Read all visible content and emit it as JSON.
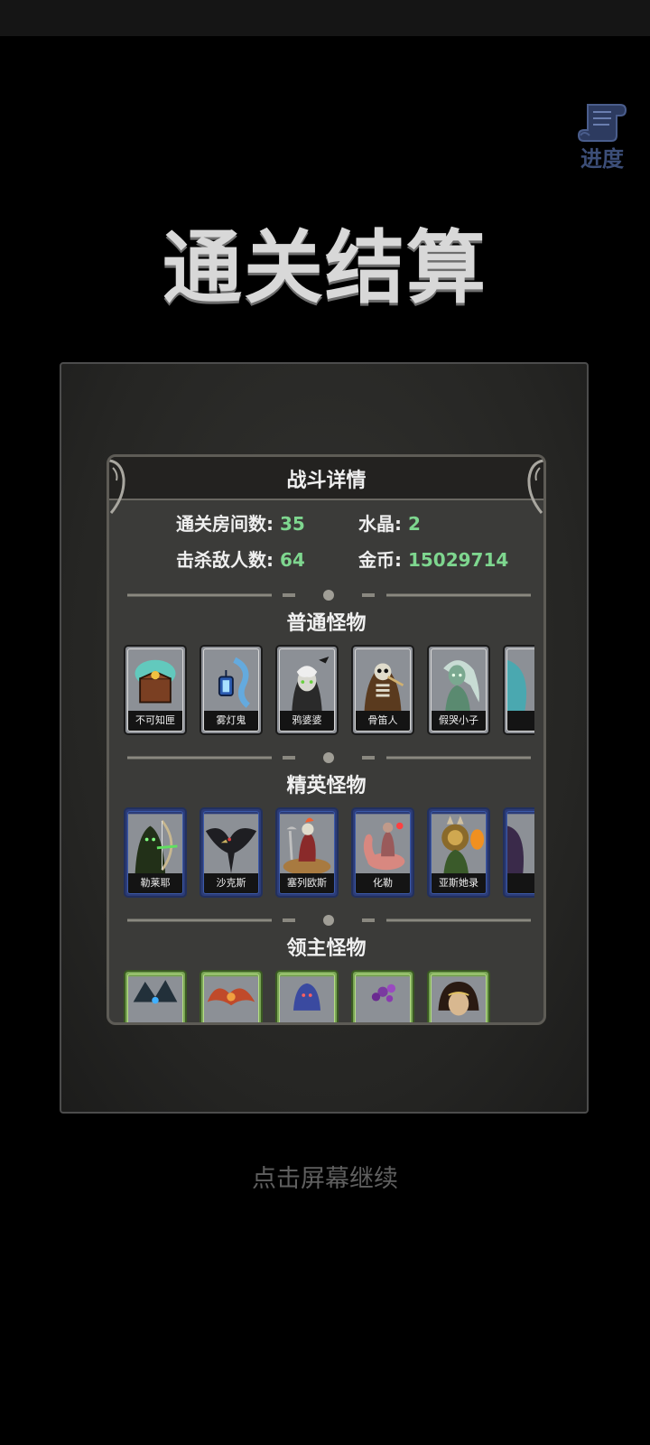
{
  "title": "通关结算",
  "progress_button": {
    "label": "进度",
    "icon": "scroll-icon"
  },
  "battle_details": {
    "header": "战斗详情",
    "stats": [
      {
        "label": "通关房间数:",
        "value": "35"
      },
      {
        "label": "水晶:",
        "value": "2"
      },
      {
        "label": "击杀敌人数:",
        "value": "64"
      },
      {
        "label": "金币:",
        "value": "15029714"
      }
    ]
  },
  "sections": {
    "normal": {
      "title": "普通怪物",
      "monsters": [
        "不可知匣",
        "雾灯鬼",
        "鸦婆婆",
        "骨笛人",
        "假哭小子",
        ""
      ]
    },
    "elite": {
      "title": "精英怪物",
      "monsters": [
        "勒莱耶",
        "沙克斯",
        "塞列欧斯",
        "化勒",
        "亚斯她录",
        ""
      ]
    },
    "boss": {
      "title": "领主怪物",
      "monsters": [
        "",
        "",
        "",
        "",
        ""
      ]
    }
  },
  "continue_text": "点击屏幕继续",
  "colors": {
    "value_green": "#7ed68f",
    "elite_border": "#2c3c78",
    "boss_border": "#7aa656"
  }
}
